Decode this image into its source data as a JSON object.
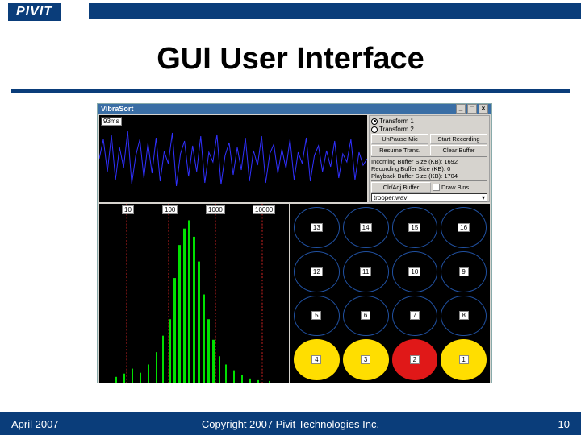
{
  "logo": "PIVIT",
  "slide": {
    "title": "GUI User Interface"
  },
  "window": {
    "title": "VibraSort",
    "ms_value": "93ms"
  },
  "controls": {
    "radio1": "Transform 1",
    "radio2": "Transform 2",
    "unpause": "UnPause Mic",
    "start_rec": "Start Recording",
    "resume": "Resume Trans.",
    "clear": "Clear Buffer",
    "info1": "Incoming Buffer Size (KB): 1692",
    "info2": "Recording Buffer Size (KB): 0",
    "info3": "Playback Buffer Size (KB): 1704",
    "clr_adj": "Clr/Adj Buffer",
    "draw_bins": "Draw Bins",
    "combo_value": "trooper.wav"
  },
  "spectrum_labels": [
    "10",
    "100",
    "1000",
    "10000"
  ],
  "grid": {
    "cells": [
      {
        "n": "13",
        "c": ""
      },
      {
        "n": "14",
        "c": ""
      },
      {
        "n": "15",
        "c": ""
      },
      {
        "n": "16",
        "c": ""
      },
      {
        "n": "12",
        "c": ""
      },
      {
        "n": "11",
        "c": ""
      },
      {
        "n": "10",
        "c": ""
      },
      {
        "n": "9",
        "c": ""
      },
      {
        "n": "5",
        "c": ""
      },
      {
        "n": "6",
        "c": ""
      },
      {
        "n": "7",
        "c": ""
      },
      {
        "n": "8",
        "c": ""
      },
      {
        "n": "4",
        "c": "y"
      },
      {
        "n": "3",
        "c": "y"
      },
      {
        "n": "2",
        "c": "r"
      },
      {
        "n": "1",
        "c": "y"
      }
    ]
  },
  "footer": {
    "left": "April 2007",
    "center": "Copyright 2007 Pivit Technologies Inc.",
    "right": "10"
  }
}
